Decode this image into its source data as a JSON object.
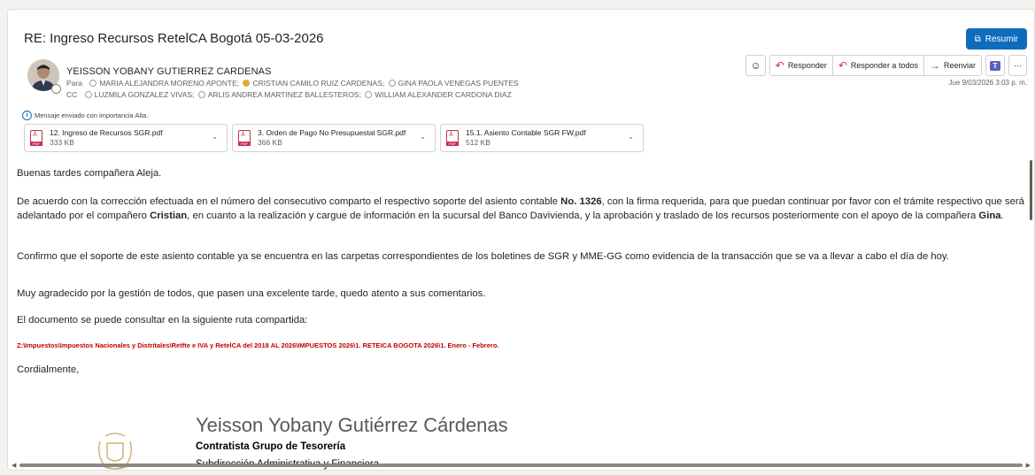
{
  "subject": "RE: Ingreso Recursos RetelCA Bogotá 05-03-2026",
  "resumir_label": "Resumir",
  "sender": "YEISSON YOBANY GUTIERREZ CARDENAS",
  "to_label": "Para",
  "to": [
    "MARIA ALEJANDRA MORENO APONTE;",
    "CRISTIAN CAMILO RUIZ CARDENAS;",
    "GINA PAOLA VENEGAS PUENTES"
  ],
  "cc_label": "CC",
  "cc": [
    "LUZMILA GONZALEZ VIVAS;",
    "ARLIS ANDREA MARTINEZ BALLESTEROS;",
    "WILLIAM ALEXANDER CARDONA DIAZ"
  ],
  "importance": "Mensaje enviado con importancia Alta.",
  "actions": {
    "reply": "Responder",
    "reply_all": "Responder a todos",
    "forward": "Reenviar",
    "more": "···"
  },
  "date": "Jue 9/03/2026 3:03 p. m.",
  "attachments": [
    {
      "name": "12. Ingreso de Recursos SGR.pdf",
      "size": "333 KB"
    },
    {
      "name": "3. Orden de Pago No Presupuestal SGR.pdf",
      "size": "366 KB"
    },
    {
      "name": "15.1. Asiento Contable SGR FW.pdf",
      "size": "512 KB"
    }
  ],
  "body": {
    "greeting": "Buenas tardes compañera Aleja.",
    "p1": [
      "De acuerdo con  la corrección efectuada en el número del consecutivo comparto el  respectivo soporte del asiento contable ",
      "No. 1326",
      ", con la firma requerida, para que puedan continuar por favor con el trámite respectivo que será adelantado por el compañero ",
      "Cristian",
      ", en cuanto a la realización y cargue de información en la sucursal del Banco Davivienda, y la aprobación y traslado de los recursos posteriormente con el apoyo de la compañera ",
      "Gina",
      "."
    ],
    "p2": "Confirmo que el soporte de este asiento contable ya se encuentra en las carpetas correspondientes de los boletines de SGR y MME-GG como evidencia de la transacción que se va a llevar a cabo el día de hoy.",
    "p3": "Muy agradecido por la gestión de todos, que pasen una excelente tarde, quedo atento a sus comentarios.",
    "p4": "El documento se puede consultar en la siguiente ruta compartida:",
    "path": "Z:\\Impuestos\\Impuestos Nacionales y Distritales\\Retfte e IVA y RetelCA del 2018 AL 2026\\IMPUESTOS 2026\\1. RETEICA BOGOTA 2026\\1. Enero - Febrero.",
    "closing": "Cordialmente,"
  },
  "signature": {
    "name": "Yeisson Yobany Gutiérrez Cárdenas",
    "role": "Contratista Grupo de Tesorería",
    "dept": "Subdirección Administrativa y Financiera"
  }
}
